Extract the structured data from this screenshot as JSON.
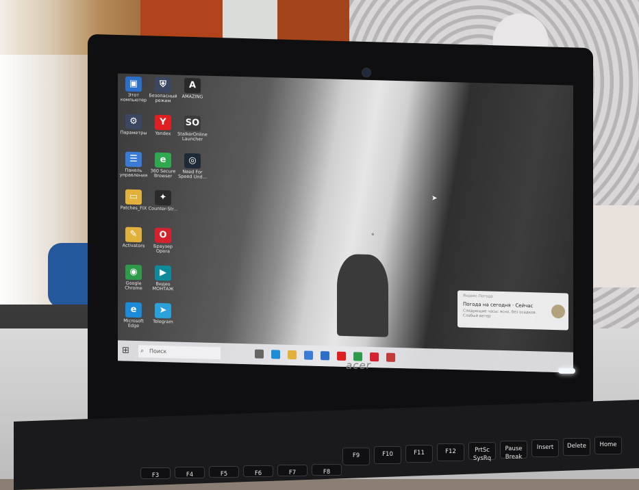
{
  "desktop": {
    "icons": [
      {
        "label": "Этот компьютер",
        "icon": "computer-icon",
        "color": "#2c6fc9"
      },
      {
        "label": "Безопасный режим",
        "icon": "safe-mode-icon",
        "color": "#3a4760"
      },
      {
        "label": "AMAZING",
        "icon": "amazing-icon",
        "color": "#2a2a2a"
      },
      {
        "label": "Параметры",
        "icon": "settings-shortcut-icon",
        "color": "#3a4760"
      },
      {
        "label": "Yandex",
        "icon": "yandex-icon",
        "color": "#e02020"
      },
      {
        "label": "StalkerOnline Launcher",
        "icon": "stalker-online-icon",
        "color": "#3b3b3b"
      },
      {
        "label": "Панель управления",
        "icon": "control-panel-icon",
        "color": "#3a7bd5"
      },
      {
        "label": "360 Secure Browser",
        "icon": "secure-browser-icon",
        "color": "#2fa84f"
      },
      {
        "label": "Need For Speed Und...",
        "icon": "nfs-icon",
        "color": "#1f2a38"
      },
      {
        "label": "Patches_FIX",
        "icon": "folder-icon",
        "color": "#e2b13c"
      },
      {
        "label": "Counter-Str...",
        "icon": "counter-strike-icon",
        "color": "#2b2b2b"
      },
      {
        "label": "",
        "icon": "blank-icon",
        "color": "#00000000"
      },
      {
        "label": "Activators",
        "icon": "activators-icon",
        "color": "#e2b13c"
      },
      {
        "label": "Браузер Opera",
        "icon": "opera-icon",
        "color": "#d4232e"
      },
      {
        "label": "",
        "icon": "blank-icon",
        "color": "#00000000"
      },
      {
        "label": "Google Chrome",
        "icon": "chrome-icon",
        "color": "#2f9a49"
      },
      {
        "label": "Видео МОНТАЖ",
        "icon": "video-editor-icon",
        "color": "#0e8a9a"
      },
      {
        "label": "",
        "icon": "blank-icon",
        "color": "#00000000"
      },
      {
        "label": "Microsoft Edge",
        "icon": "edge-icon",
        "color": "#1c8cd8"
      },
      {
        "label": "Telegram",
        "icon": "telegram-icon",
        "color": "#2aa1da"
      }
    ]
  },
  "taskbar": {
    "search_placeholder": "Поиск",
    "apps": [
      {
        "icon": "task-view-icon",
        "color": "#666666"
      },
      {
        "icon": "edge-taskbar-icon",
        "color": "#1c8cd8"
      },
      {
        "icon": "explorer-icon",
        "color": "#e2b13c"
      },
      {
        "icon": "store-icon",
        "color": "#3a7bd5"
      },
      {
        "icon": "mail-icon",
        "color": "#2c6fc9"
      },
      {
        "icon": "yandex-taskbar-icon",
        "color": "#e02020"
      },
      {
        "icon": "chrome-taskbar-icon",
        "color": "#2f9a49"
      },
      {
        "icon": "opera-taskbar-icon",
        "color": "#d4232e"
      },
      {
        "icon": "yandex-browser-taskbar-icon",
        "color": "#c23a3a"
      }
    ]
  },
  "notification": {
    "app": "Яндекс.Погода",
    "title": "Погода на сегодня · Сейчас",
    "body": "Следующие часы: ясно, без осадков. Слабый ветер"
  },
  "laptop": {
    "brand": "acer"
  },
  "keyboard": {
    "keys": [
      "F9",
      "F10",
      "F11",
      "F12",
      "PrtSc SysRq",
      "Pause Break",
      "Insert",
      "Delete",
      "Home"
    ],
    "bottom_keys": [
      "F3",
      "F4",
      "F5",
      "F6",
      "F7",
      "F8"
    ]
  }
}
